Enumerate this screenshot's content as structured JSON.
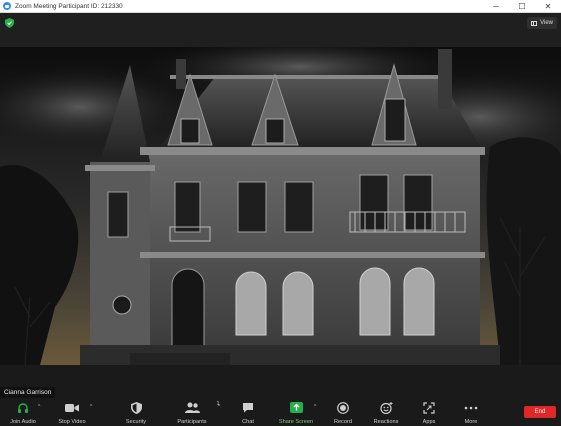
{
  "window": {
    "title": "Zoom Meeting Participant ID: 212330",
    "controls": [
      "─",
      "☐",
      "✕"
    ]
  },
  "header": {
    "view_label": "View"
  },
  "participant": {
    "name": "Cianna Garrison"
  },
  "toolbar": {
    "join_audio": "Join Audio",
    "stop_video": "Stop Video",
    "security": "Security",
    "participants": "Participants",
    "participants_count": "1",
    "chat": "Chat",
    "share_screen": "Share Screen",
    "record": "Record",
    "reactions": "Reactions",
    "apps": "Apps",
    "more": "More",
    "end": "End"
  },
  "colors": {
    "accent_green": "#22b14c",
    "end_red": "#e02828",
    "zoom_blue": "#2d8cff"
  }
}
